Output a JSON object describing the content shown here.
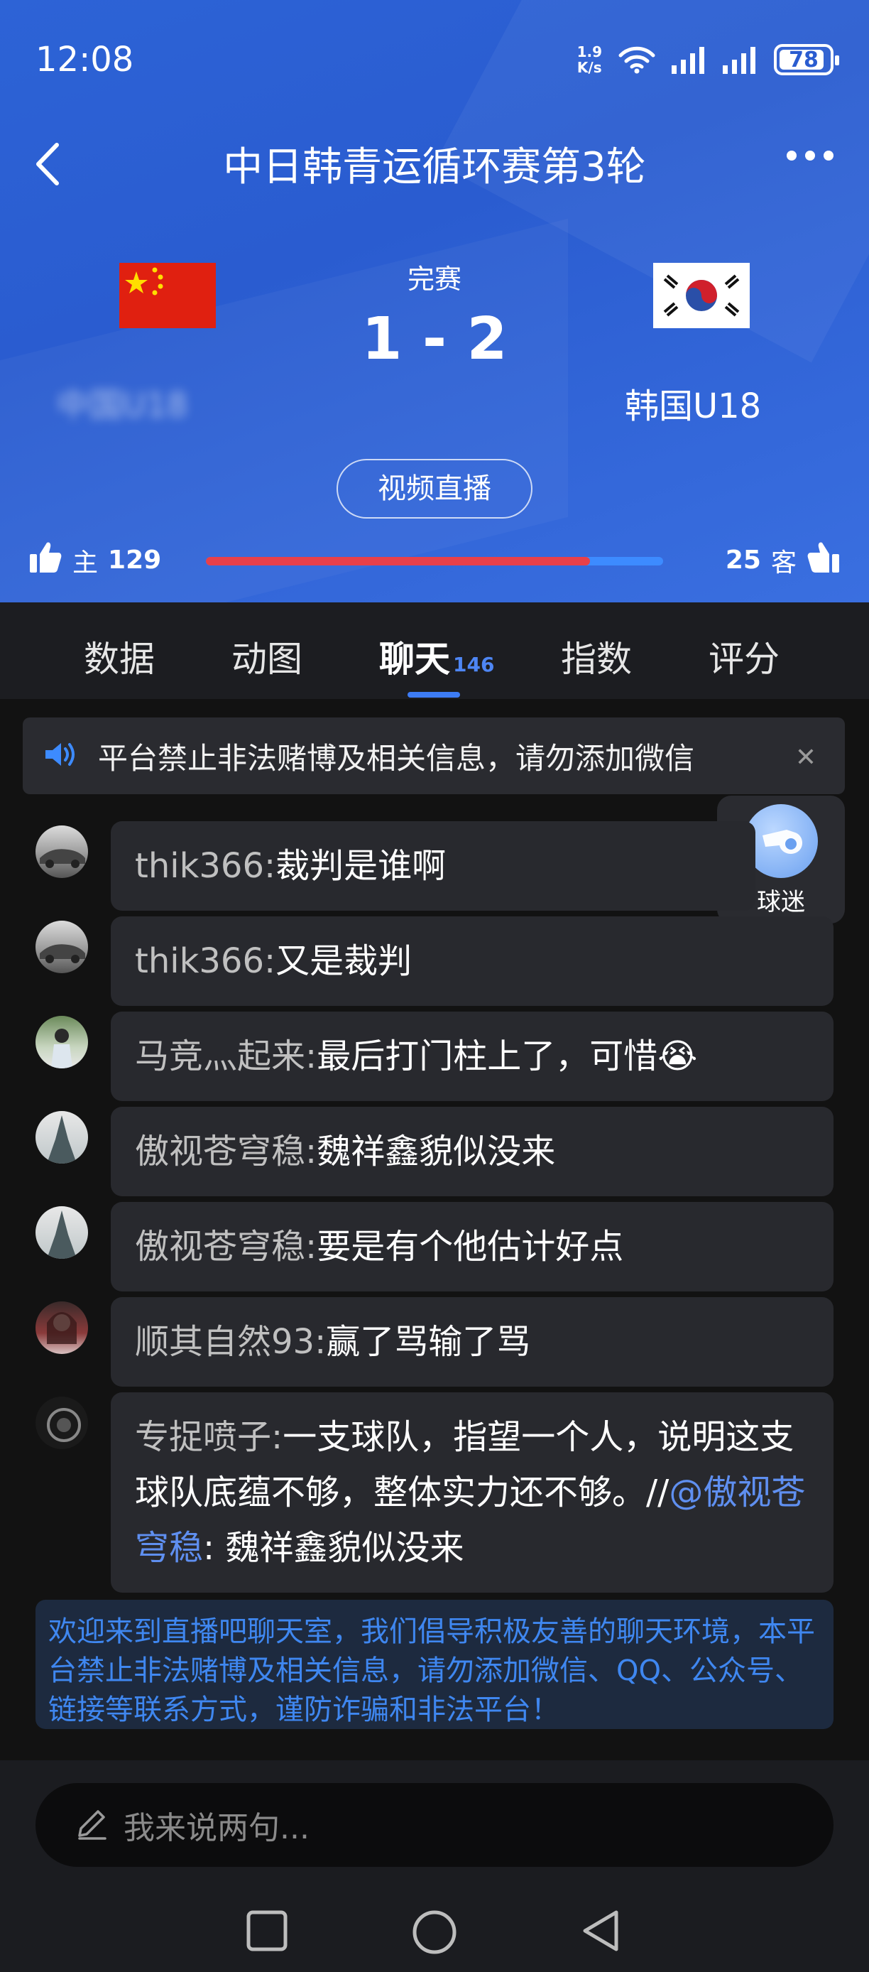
{
  "status_bar": {
    "time": "12:08",
    "net_speed_value": "1.9",
    "net_speed_unit": "K/s",
    "battery": "78",
    "icons": [
      "wifi-icon",
      "signal-icon",
      "signal-icon",
      "battery-icon"
    ]
  },
  "header": {
    "title": "中日韩青运循环赛第3轮",
    "back_icon": "back-arrow-icon",
    "more_icon": "more-dots-icon"
  },
  "match": {
    "status": "完赛",
    "score": "1 - 2",
    "home_team": "中国U18",
    "away_team": "韩国U18",
    "home_flag": "china-flag",
    "away_flag": "korea-flag",
    "video_button": "视频直播"
  },
  "votes": {
    "home_label": "主",
    "home_count": "129",
    "away_label": "客",
    "away_count": "25",
    "home_share": 0.84,
    "home_color": "#e8404a",
    "away_color": "#3d8bff"
  },
  "tabs": [
    {
      "label": "数据"
    },
    {
      "label": "动图"
    },
    {
      "label": "聊天",
      "count": "146",
      "active": true
    },
    {
      "label": "指数"
    },
    {
      "label": "评分"
    }
  ],
  "notice": {
    "icon": "speaker-icon",
    "text": "平台禁止非法赌博及相关信息，请勿添加微信",
    "close_icon": "close-icon"
  },
  "fan_button": {
    "label": "球迷",
    "icon": "whistle-icon"
  },
  "messages": [
    {
      "user": "thik366:",
      "text": "裁判是谁啊"
    },
    {
      "user": "thik366:",
      "text": "又是裁判"
    },
    {
      "user": "马竞灬起来:",
      "text": "最后打门柱上了，可惜😭"
    },
    {
      "user": "傲视苍穹稳:",
      "text": "魏祥鑫貌似没来"
    },
    {
      "user": "傲视苍穹稳:",
      "text": "要是有个他估计好点"
    },
    {
      "user": "顺其自然93:",
      "text": "赢了骂输了骂"
    },
    {
      "user": "专捉喷子:",
      "text": "一支球队，指望一个人，说明这支球队底蕴不够，整体实力还不够。//",
      "mention": "@傲视苍穹稳",
      "quote": ": 魏祥鑫貌似没来"
    }
  ],
  "welcome": "欢迎来到直播吧聊天室，我们倡导积极友善的聊天环境，本平台禁止非法赌博及相关信息，请勿添加微信、QQ、公众号、链接等联系方式，谨防诈骗和非法平台！",
  "input": {
    "placeholder": "我来说两句...",
    "icon": "pencil-icon"
  },
  "navbar": {
    "icons": [
      "recent-apps-icon",
      "home-icon",
      "back-icon"
    ]
  },
  "colors": {
    "header_bg": "#2d63d6",
    "accent": "#3d7cf5",
    "background": "#121212",
    "bubble": "#28292e"
  }
}
